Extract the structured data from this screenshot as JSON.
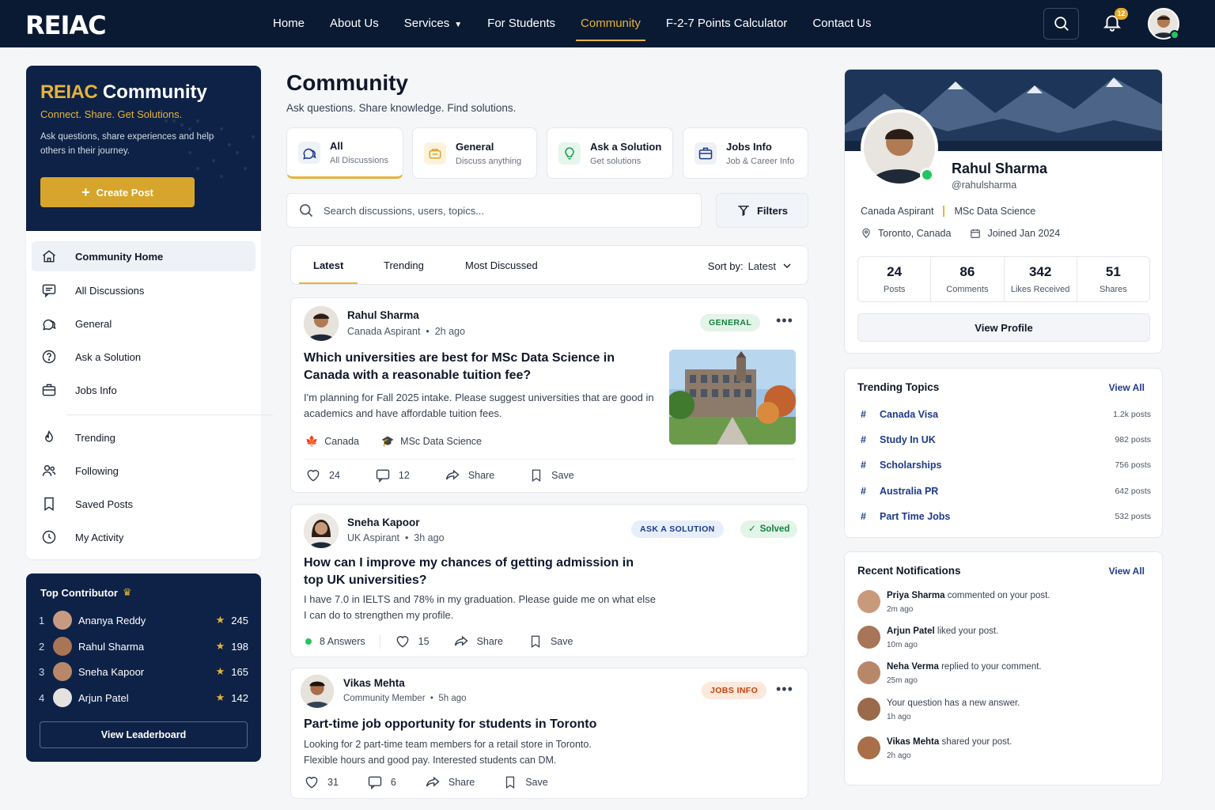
{
  "nav": {
    "logo": "REIAC",
    "items": [
      "Home",
      "About Us",
      "Services",
      "For Students",
      "Community",
      "F-2-7 Points Calculator",
      "Contact Us"
    ],
    "active": "Community",
    "notification_count": "12"
  },
  "colors": {
    "navy": "#0b1a33",
    "gold": "#e6b33a",
    "accent_blue": "#1e3a8a",
    "online": "#22c55e"
  },
  "left": {
    "hero_brand": "REIAC",
    "hero_title": "Community",
    "hero_tagline": "Connect. Share. Get Solutions.",
    "hero_desc": "Ask questions, share experiences and help others in their journey.",
    "create_label": "Create Post",
    "menu": [
      {
        "label": "Community Home",
        "icon": "home-icon"
      },
      {
        "label": "All Discussions",
        "icon": "discussions-icon"
      },
      {
        "label": "General",
        "icon": "chat-icon"
      },
      {
        "label": "Ask a Solution",
        "icon": "question-icon"
      },
      {
        "label": "Jobs Info",
        "icon": "briefcase-icon"
      },
      {
        "label": "Trending",
        "icon": "trending-icon"
      },
      {
        "label": "Following",
        "icon": "users-icon"
      },
      {
        "label": "Saved Posts",
        "icon": "bookmark-icon"
      },
      {
        "label": "My Activity",
        "icon": "clock-icon"
      }
    ],
    "contrib_title": "Top Contributor",
    "contributors": [
      {
        "rank": "1",
        "name": "Ananya Reddy",
        "score": "245"
      },
      {
        "rank": "2",
        "name": "Rahul Sharma",
        "score": "198"
      },
      {
        "rank": "3",
        "name": "Sneha Kapoor",
        "score": "165"
      },
      {
        "rank": "4",
        "name": "Arjun Patel",
        "score": "142"
      }
    ],
    "leaderboard_label": "View Leaderboard"
  },
  "main": {
    "title": "Community",
    "subtitle": "Ask questions. Share knowledge. Find solutions.",
    "categories": [
      {
        "title": "All",
        "sub": "All Discussions"
      },
      {
        "title": "General",
        "sub": "Discuss anything"
      },
      {
        "title": "Ask a Solution",
        "sub": "Get solutions"
      },
      {
        "title": "Jobs Info",
        "sub": "Job & Career Info"
      }
    ],
    "search_placeholder": "Search discussions, users, topics...",
    "filters_label": "Filters",
    "tabs": [
      "Latest",
      "Trending",
      "Most Discussed"
    ],
    "sort_label": "Sort by:",
    "sort_value": "Latest",
    "posts": [
      {
        "author": "Rahul Sharma",
        "role": "Canada Aspirant",
        "time": "2h ago",
        "badge": "GENERAL",
        "title": "Which universities are best for MSc Data Science in Canada with a reasonable tuition fee?",
        "body": "I'm planning for Fall 2025 intake. Please suggest universities that are good in academics and have affordable tuition fees.",
        "tags": [
          "Canada",
          "MSc Data Science"
        ],
        "likes": "24",
        "comments": "12",
        "share": "Share",
        "save": "Save"
      },
      {
        "author": "Sneha Kapoor",
        "role": "UK Aspirant",
        "time": "3h ago",
        "badge": "ASK A SOLUTION",
        "status": "Solved",
        "title": "How can I improve my chances of getting admission in top UK universities?",
        "body": "I have 7.0 in IELTS and 78% in my graduation. Please guide me on what else I can do to strengthen my profile.",
        "answers": "8 Answers",
        "likes": "15",
        "share": "Share",
        "save": "Save"
      },
      {
        "author": "Vikas Mehta",
        "role": "Community Member",
        "time": "5h ago",
        "badge": "JOBS INFO",
        "title": "Part-time job opportunity for students in Toronto",
        "body": "Looking for 2 part-time team members for a retail store in Toronto. Flexible hours and good pay. Interested students can DM.",
        "likes": "31",
        "comments": "6",
        "share": "Share",
        "save": "Save"
      }
    ]
  },
  "profile": {
    "name": "Rahul Sharma",
    "handle": "@rahulsharma",
    "role": "Canada Aspirant",
    "program": "MSc Data Science",
    "location": "Toronto, Canada",
    "joined": "Joined Jan 2024",
    "stats": [
      {
        "value": "24",
        "label": "Posts"
      },
      {
        "value": "86",
        "label": "Comments"
      },
      {
        "value": "342",
        "label": "Likes Received"
      },
      {
        "value": "51",
        "label": "Shares"
      }
    ],
    "view_profile": "View Profile"
  },
  "trending": {
    "title": "Trending Topics",
    "view_all": "View All",
    "topics": [
      {
        "name": "Canada Visa",
        "count": "1.2k posts"
      },
      {
        "name": "Study In UK",
        "count": "982 posts"
      },
      {
        "name": "Scholarships",
        "count": "756 posts"
      },
      {
        "name": "Australia PR",
        "count": "642 posts"
      },
      {
        "name": "Part Time Jobs",
        "count": "532 posts"
      }
    ]
  },
  "notifications": {
    "title": "Recent Notifications",
    "view_all": "View All",
    "items": [
      {
        "who": "Priya Sharma",
        "what": "commented on your post.",
        "when": "2m ago"
      },
      {
        "who": "Arjun Patel",
        "what": "liked your post.",
        "when": "10m ago"
      },
      {
        "who": "Neha Verma",
        "what": "replied to your comment.",
        "when": "25m ago"
      },
      {
        "who": "",
        "what": "Your question has a new answer.",
        "when": "1h ago"
      },
      {
        "who": "Vikas Mehta",
        "what": "shared your post.",
        "when": "2h ago"
      }
    ]
  }
}
